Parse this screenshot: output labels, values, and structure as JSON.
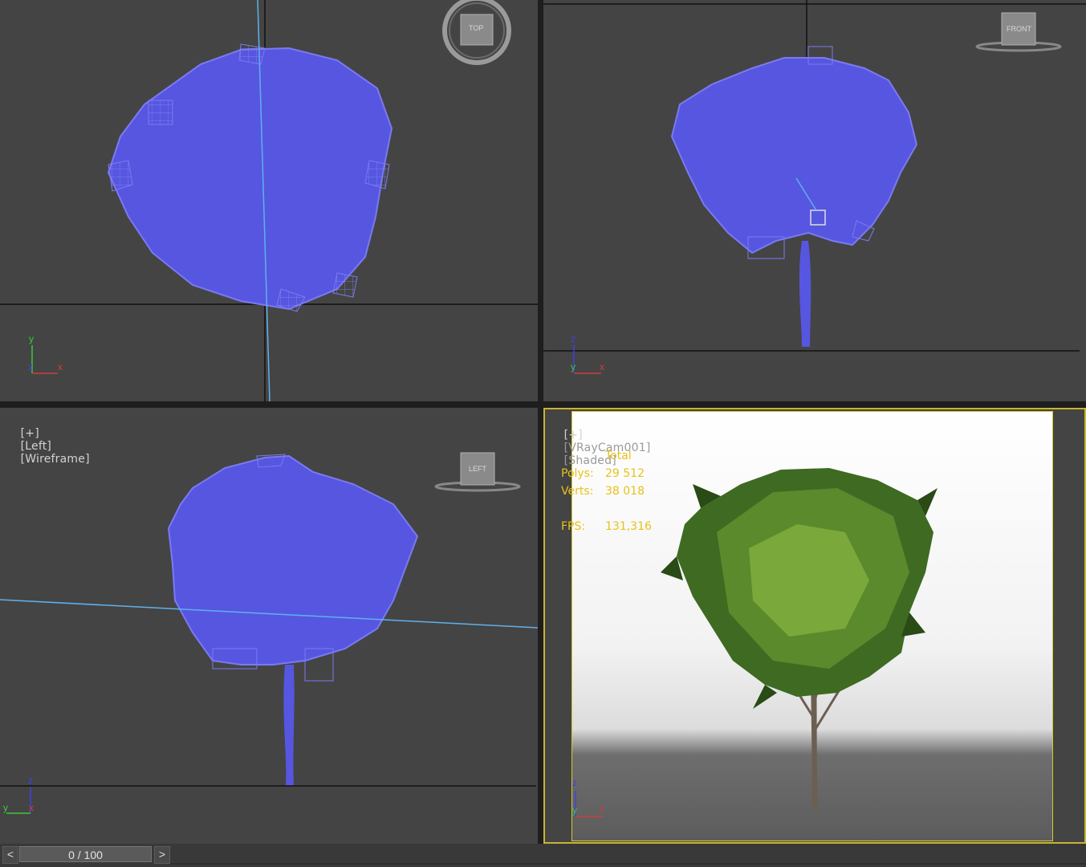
{
  "viewports": {
    "top": {
      "label_plus": "[+]",
      "label_view": "",
      "label_mode": "",
      "navcube": "TOP"
    },
    "front": {
      "label_plus": "[+]",
      "label_view": "",
      "label_mode": "",
      "navcube": "FRONT"
    },
    "left": {
      "label_plus": "[+]",
      "label_view": "[Left]",
      "label_mode": "[Wireframe]",
      "navcube": "LEFT"
    },
    "camera": {
      "label_plus": "[+]",
      "label_view": "[VRayCam001]",
      "label_mode": "[Shaded]"
    }
  },
  "stats": {
    "header": "Total",
    "polys_label": "Polys:",
    "polys_value": "29 512",
    "verts_label": "Verts:",
    "verts_value": "38 018",
    "fps_label": "FPS:",
    "fps_value": "131,316"
  },
  "axes": {
    "x": "x",
    "y": "y",
    "z": "z"
  },
  "timeline": {
    "prev": "<",
    "frame": "0 / 100",
    "next": ">"
  },
  "colors": {
    "viewport_bg": "#444444",
    "wireframe": "#5656e0",
    "active_border": "#c8b432",
    "stats_text": "#e6c21a",
    "axis_x": "#d23c3c",
    "axis_y": "#3cc83c",
    "axis_z": "#4040e6"
  },
  "icons": [
    "viewcube-top-icon",
    "viewcube-front-icon",
    "viewcube-left-icon",
    "axis-tripod-icon"
  ]
}
